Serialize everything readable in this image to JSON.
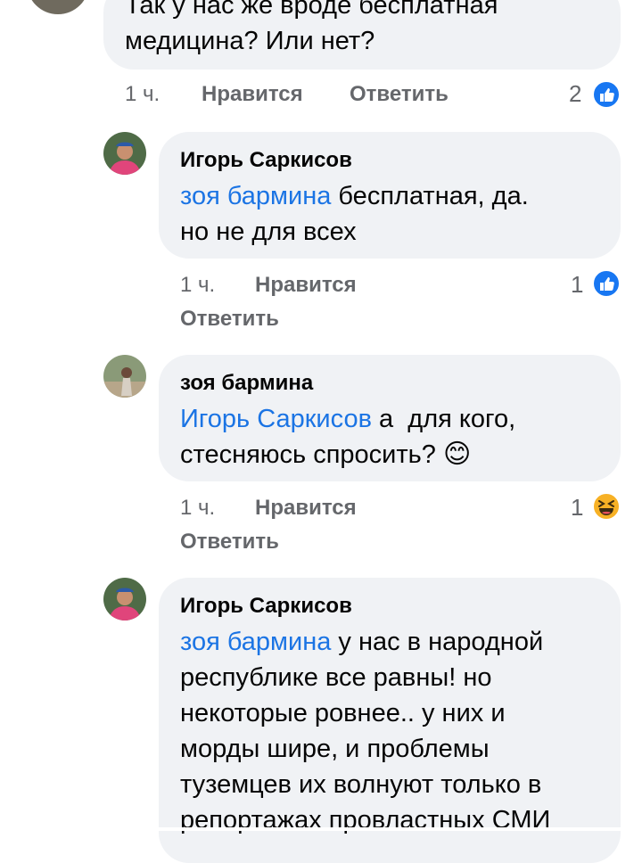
{
  "comment1": {
    "text_line1": "Так у нас же вроде бесплатная",
    "text_line2": "медицина? Или нет?",
    "time": "1 ч.",
    "like": "Нравится",
    "reply": "Ответить",
    "reactions": "2",
    "reaction_icon": "like-icon"
  },
  "comment2": {
    "author": "Игорь Саркисов",
    "mention": "зоя бармина",
    "text_line1_rest": " бесплатная, да.",
    "text_line2": "но не для всех",
    "time": "1 ч.",
    "like": "Нравится",
    "reply": "Ответить",
    "reactions": "1",
    "reaction_icon": "like-icon"
  },
  "comment3": {
    "author": "зоя бармина",
    "mention": "Игорь Саркисов",
    "text_line1_rest": " а  для кого,",
    "text_line2": "стесняюсь спросить?",
    "emoji": "😊",
    "time": "1 ч.",
    "like": "Нравится",
    "reply": "Ответить",
    "reactions": "1",
    "reaction_icon": "haha-icon"
  },
  "comment4": {
    "author": "Игорь Саркисов",
    "mention": "зоя бармина",
    "text_line1_rest": " у нас в народной",
    "text_line2": "республике все равны! но",
    "text_line3": "некоторые ровнее.. у них и",
    "text_line4": "морды шире, и проблемы",
    "text_line5": "туземцев их волнуют только в",
    "text_line6": "репортажах провластных СМИ"
  },
  "colors": {
    "bubble": "#f0f2f5",
    "mention": "#1b74e4",
    "meta": "#65676b",
    "like_blue": "#1877f2",
    "haha_yellow": "#f7b125"
  }
}
